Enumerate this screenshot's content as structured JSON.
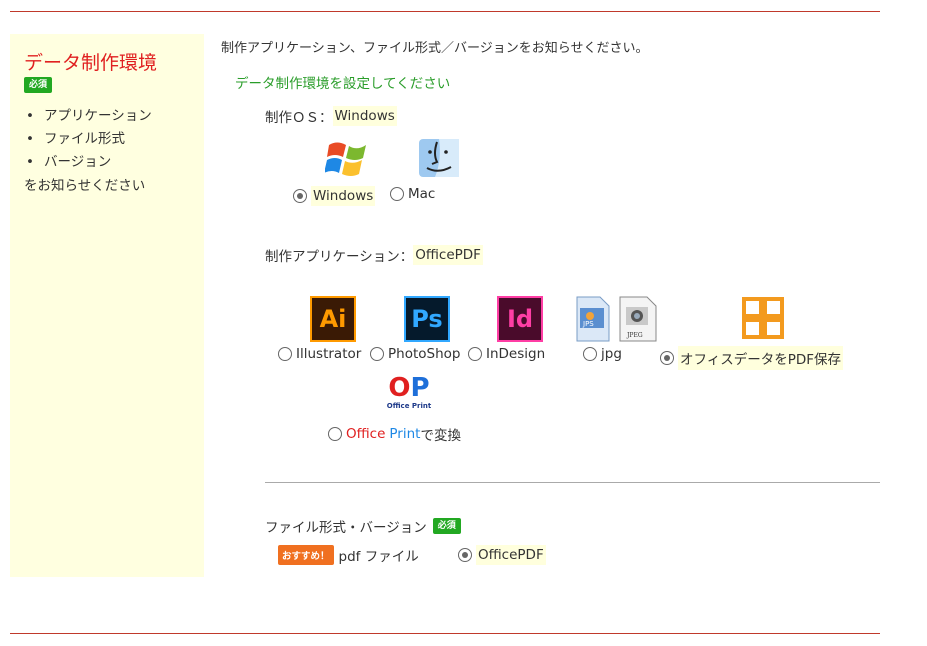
{
  "sidebar": {
    "title": "データ制作環境",
    "required_badge": "必須",
    "items": [
      {
        "label": "アプリケーション"
      },
      {
        "label": "ファイル形式"
      },
      {
        "label": "バージョン"
      }
    ],
    "note": "をお知らせください"
  },
  "main": {
    "intro": "制作アプリケーション、ファイル形式／バージョンをお知らせください。",
    "section_title": "データ制作環境を設定してください",
    "os": {
      "label": "制作ＯＳ：",
      "selected_value": "Windows",
      "options": [
        {
          "label": "Windows",
          "selected": true
        },
        {
          "label": "Mac",
          "selected": false
        }
      ]
    },
    "app": {
      "label": "制作アプリケーション：",
      "selected_value": "OfficePDF",
      "icons": {
        "ai": "Ai",
        "ps": "Ps",
        "id": "Id",
        "jps": "JPS",
        "jpeg": "JPEG"
      },
      "options": [
        {
          "label": "Illustrator",
          "selected": false
        },
        {
          "label": "PhotoShop",
          "selected": false
        },
        {
          "label": "InDesign",
          "selected": false
        },
        {
          "label": "jpg",
          "selected": false
        },
        {
          "label": "オフィスデータをPDF保存",
          "selected": true
        }
      ],
      "office_print": {
        "logo_text": "OP",
        "logo_sub": "Office Print",
        "label_office": "Office",
        "label_print": "Print",
        "label_suffix": "で変換"
      }
    },
    "format": {
      "label": "ファイル形式・バージョン",
      "required_badge": "必須",
      "recommend_badge": "おすすめ！",
      "format_text": "pdf ファイル",
      "option": {
        "label": "OfficePDF",
        "selected": true
      }
    }
  },
  "colors": {
    "accent_red": "#e02020",
    "green": "#22a822",
    "orange": "#f07020",
    "highlight": "#ffffdd",
    "sidebar_bg": "#ffffe0"
  }
}
